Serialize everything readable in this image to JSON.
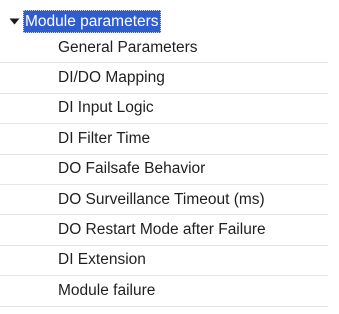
{
  "tree": {
    "root": {
      "label": "Module parameters",
      "expanded": true,
      "selected": true,
      "expander_icon": "triangle-down-icon"
    },
    "items": [
      {
        "label": "General Parameters"
      },
      {
        "label": "DI/DO Mapping"
      },
      {
        "label": "DI Input Logic"
      },
      {
        "label": "DI Filter Time"
      },
      {
        "label": "DO Failsafe Behavior"
      },
      {
        "label": "DO Surveillance Timeout (ms)"
      },
      {
        "label": "DO Restart Mode after Failure"
      },
      {
        "label": "DI Extension"
      },
      {
        "label": "Module failure"
      }
    ]
  },
  "colors": {
    "selection_bg": "#2f5ecc",
    "selection_text": "#ffffff",
    "row_divider": "#e6e6e6",
    "text": "#1f1f1f"
  }
}
